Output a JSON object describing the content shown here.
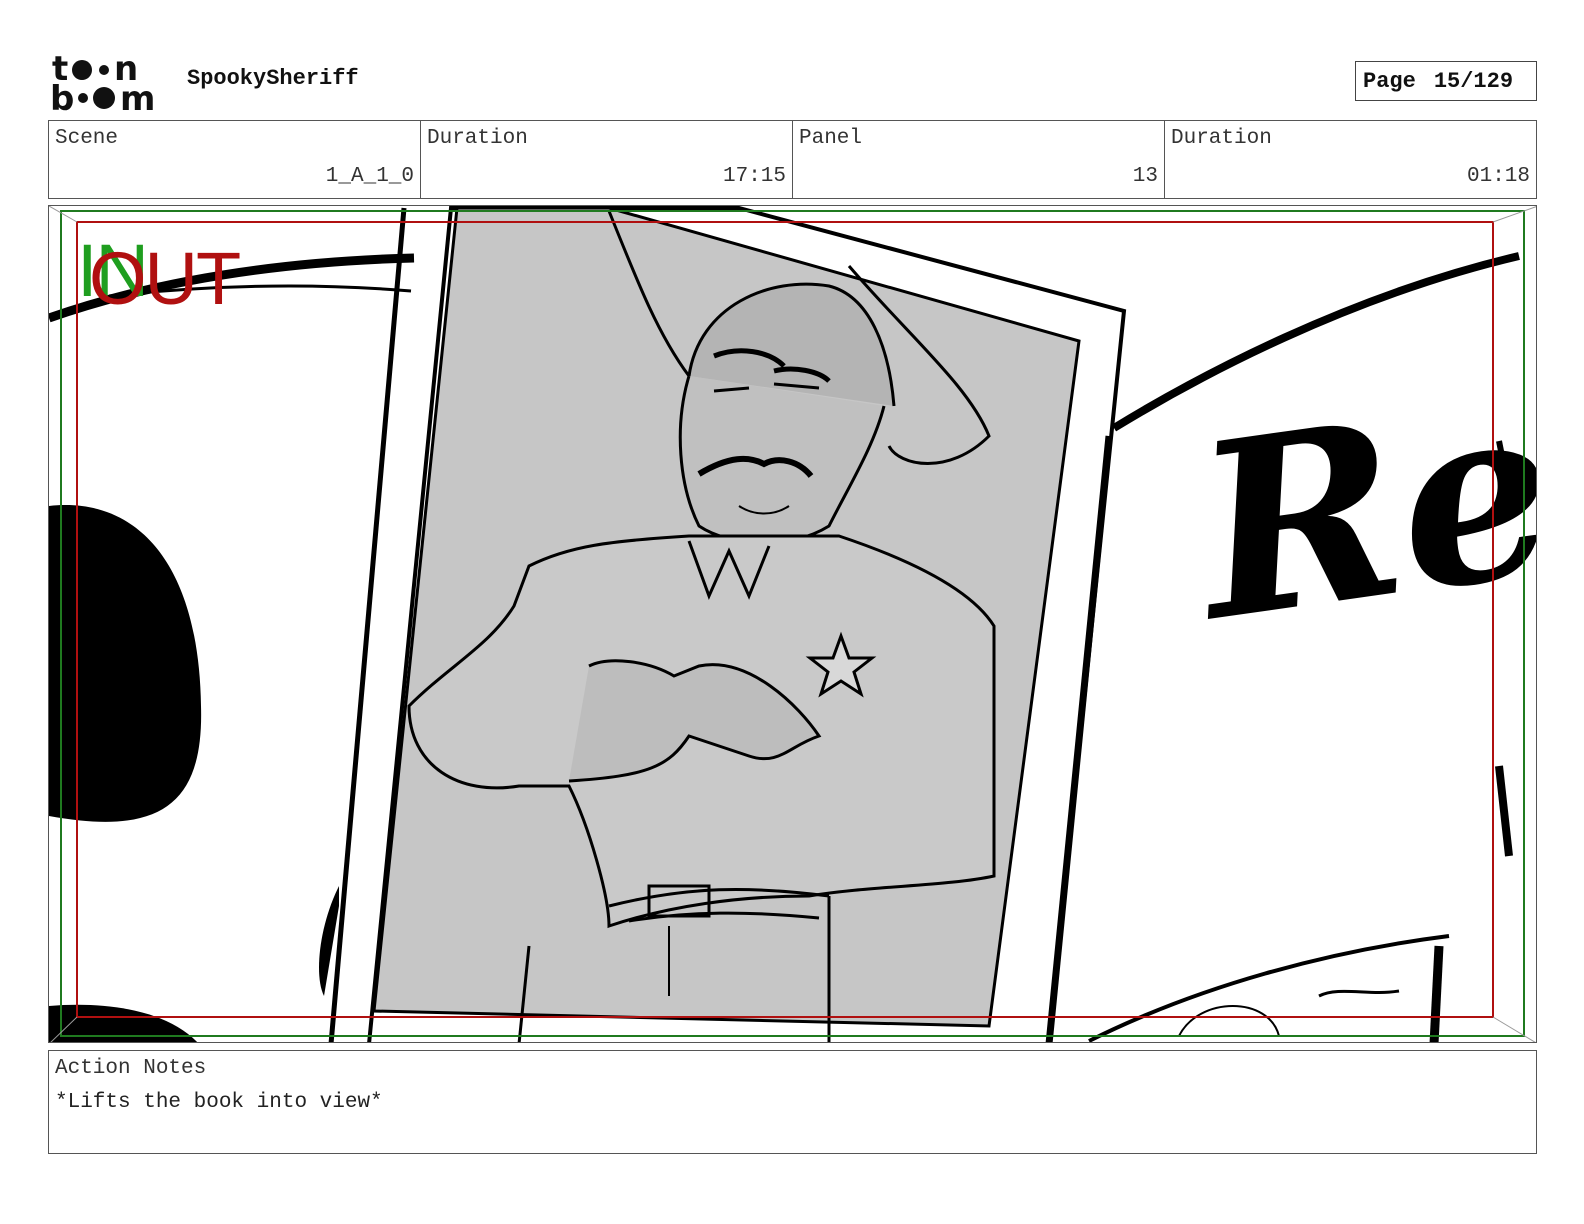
{
  "header": {
    "logo_text": "toon boom",
    "project_name": "SpookySheriff",
    "page_label": "Page",
    "page_value": "15/129"
  },
  "info": {
    "scene_label": "Scene",
    "scene_value": "1_A_1_0",
    "scene_duration_label": "Duration",
    "scene_duration_value": "17:15",
    "panel_label": "Panel",
    "panel_value": "13",
    "panel_duration_label": "Duration",
    "panel_duration_value": "01:18"
  },
  "frame": {
    "in_label": "IN",
    "out_label": "OUT",
    "sign_text": "Re"
  },
  "notes": {
    "label": "Action Notes",
    "text": "*Lifts the book into view*"
  },
  "colors": {
    "safe_inner": "#b01010",
    "safe_outer": "#1f7a1f",
    "photo_fill": "#c6c6c6"
  }
}
